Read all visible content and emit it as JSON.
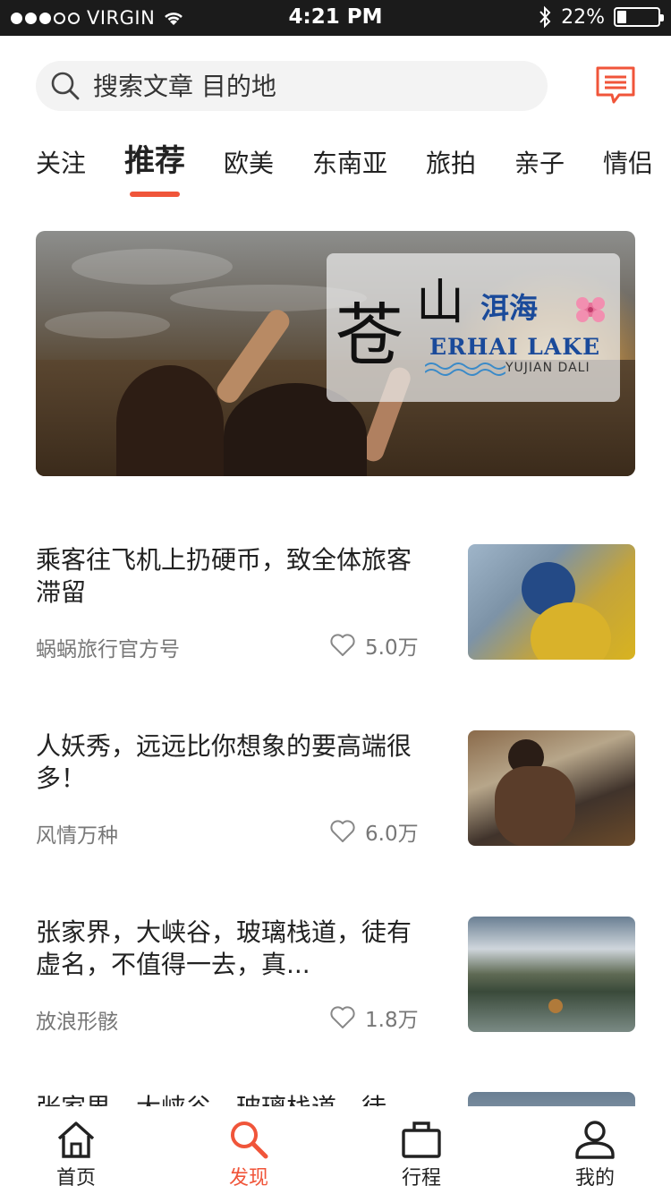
{
  "status_bar": {
    "carrier": "VIRGIN",
    "time": "4:21 PM",
    "battery_percent": "22%",
    "battery_level": 0.22,
    "signal_dots_filled": 3,
    "signal_dots_total": 5
  },
  "search": {
    "placeholder": "搜索文章 目的地",
    "icon": "search-icon"
  },
  "header": {
    "message_icon": "message-icon",
    "accent_color": "#f0553a"
  },
  "tabs": [
    {
      "label": "关注",
      "active": false
    },
    {
      "label": "推荐",
      "active": true
    },
    {
      "label": "欧美",
      "active": false
    },
    {
      "label": "东南亚",
      "active": false
    },
    {
      "label": "旅拍",
      "active": false
    },
    {
      "label": "亲子",
      "active": false
    },
    {
      "label": "情侣",
      "active": false
    }
  ],
  "banner": {
    "title_cn_1": "苍",
    "title_cn_2": "山",
    "title_cn_3": "洱海",
    "title_en": "ERHAI LAKE",
    "subtitle_en": "YUJIAN DALI"
  },
  "articles": [
    {
      "title": "乘客往飞机上扔硬币，致全体旅客滞留",
      "author": "蜗蜗旅行官方号",
      "likes": "5.0万"
    },
    {
      "title": "人妖秀，远远比你想象的要高端很多！",
      "author": "风情万种",
      "likes": "6.0万"
    },
    {
      "title": "张家界，大峡谷，玻璃栈道，徒有虚名，不值得一去，真...",
      "author": "放浪形骸",
      "likes": "1.8万"
    },
    {
      "title": "张家界，大峡谷，玻璃栈道，徒",
      "author": "",
      "likes": ""
    }
  ],
  "bottom_nav": [
    {
      "label": "首页",
      "icon": "home-icon",
      "active": false
    },
    {
      "label": "发现",
      "icon": "discover-search-icon",
      "active": true
    },
    {
      "label": "行程",
      "icon": "briefcase-icon",
      "active": false
    },
    {
      "label": "我的",
      "icon": "profile-icon",
      "active": false
    }
  ]
}
